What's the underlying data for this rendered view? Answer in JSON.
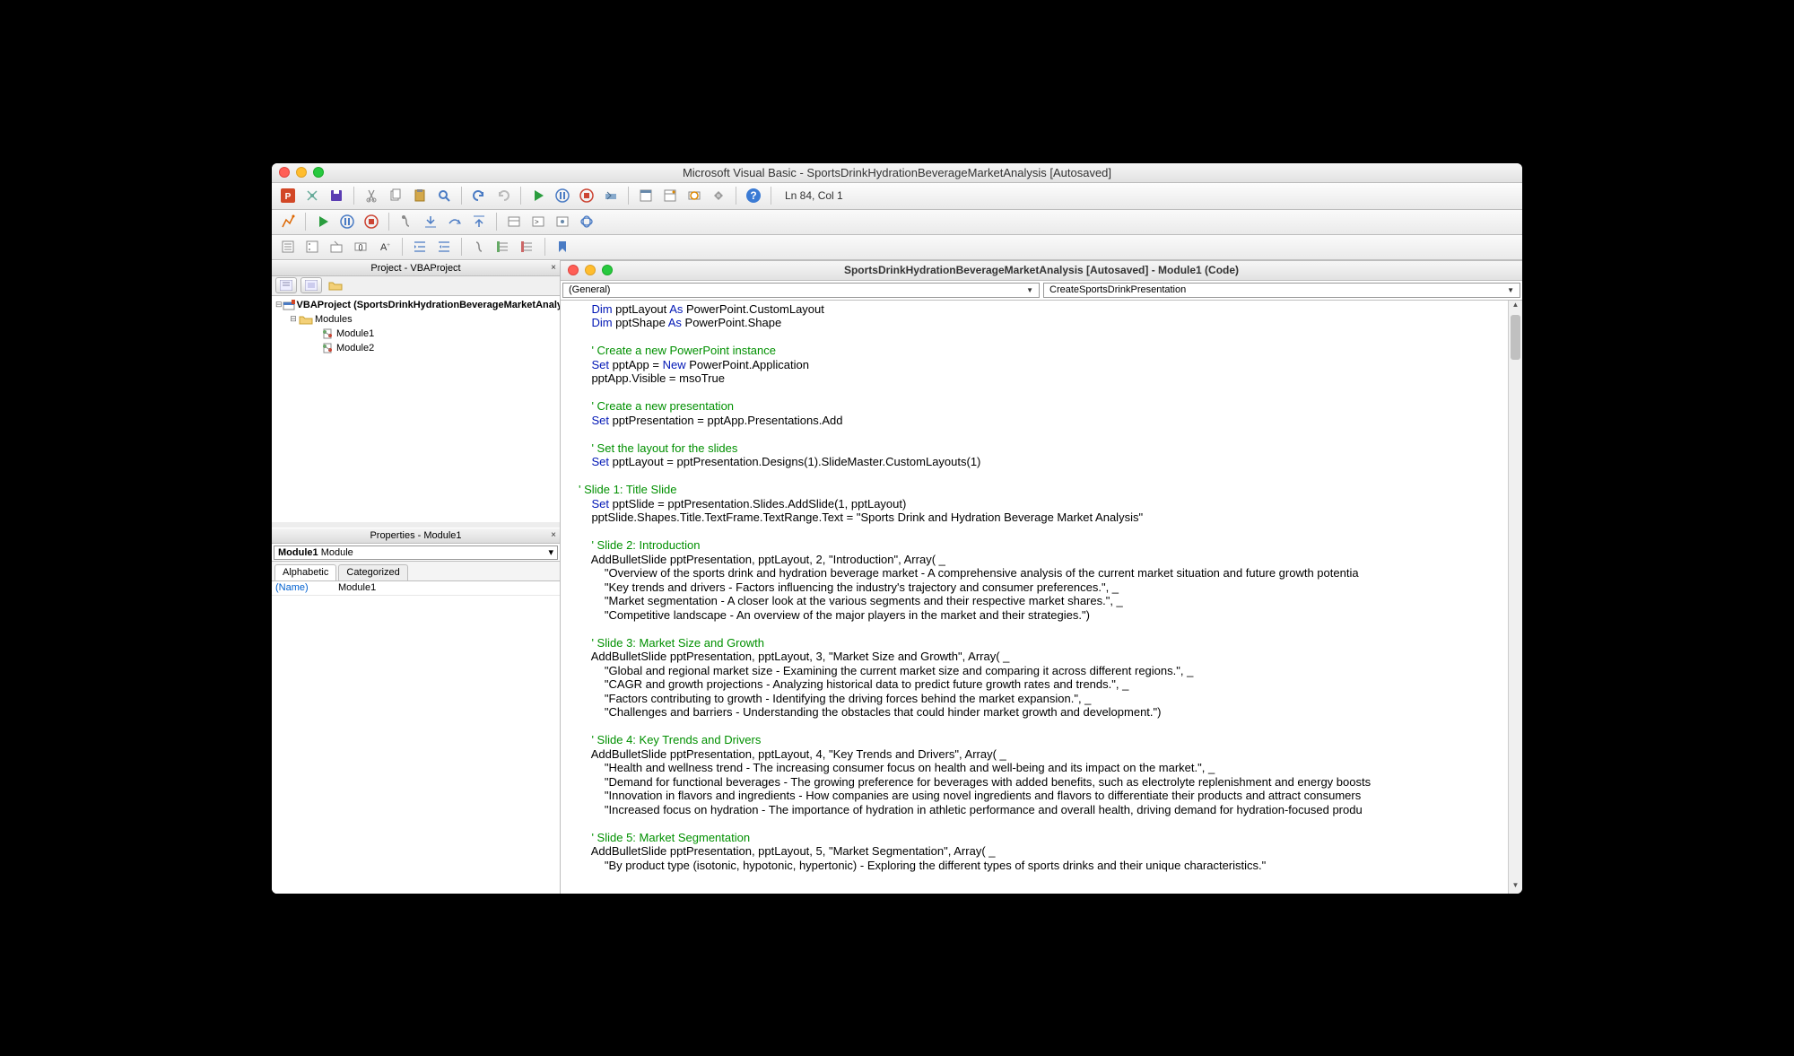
{
  "window": {
    "title": "Microsoft Visual Basic - SportsDrinkHydrationBeverageMarketAnalysis [Autosaved]"
  },
  "toolbar1": {
    "cursor_pos": "Ln 84, Col 1"
  },
  "project_pane": {
    "title": "Project - VBAProject",
    "root": "VBAProject (SportsDrinkHydrationBeverageMarketAnalys...)",
    "modules_folder": "Modules",
    "module1": "Module1",
    "module2": "Module2"
  },
  "properties_pane": {
    "title": "Properties - Module1",
    "select_label": "Module1",
    "select_type": "Module",
    "tab_alpha": "Alphabetic",
    "tab_cat": "Categorized",
    "name_key": "(Name)",
    "name_val": "Module1"
  },
  "code_window": {
    "title": "SportsDrinkHydrationBeverageMarketAnalysis [Autosaved] - Module1 (Code)",
    "dropdown_left": "(General)",
    "dropdown_right": "CreateSportsDrinkPresentation"
  },
  "code_lines": [
    {
      "indent": 1,
      "tokens": [
        [
          "kw",
          "Dim"
        ],
        [
          "",
          " pptLayout "
        ],
        [
          "kw",
          "As"
        ],
        [
          "",
          " PowerPoint.CustomLayout"
        ]
      ]
    },
    {
      "indent": 1,
      "tokens": [
        [
          "kw",
          "Dim"
        ],
        [
          "",
          " pptShape "
        ],
        [
          "kw",
          "As"
        ],
        [
          "",
          " PowerPoint.Shape"
        ]
      ]
    },
    {
      "indent": 0,
      "tokens": [
        [
          "",
          ""
        ]
      ]
    },
    {
      "indent": 1,
      "tokens": [
        [
          "cm",
          "' Create a new PowerPoint instance"
        ]
      ]
    },
    {
      "indent": 1,
      "tokens": [
        [
          "kw",
          "Set"
        ],
        [
          "",
          " pptApp = "
        ],
        [
          "kw",
          "New"
        ],
        [
          "",
          " PowerPoint.Application"
        ]
      ]
    },
    {
      "indent": 1,
      "tokens": [
        [
          "",
          "pptApp.Visible = msoTrue"
        ]
      ]
    },
    {
      "indent": 0,
      "tokens": [
        [
          "",
          ""
        ]
      ]
    },
    {
      "indent": 1,
      "tokens": [
        [
          "cm",
          "' Create a new presentation"
        ]
      ]
    },
    {
      "indent": 1,
      "tokens": [
        [
          "kw",
          "Set"
        ],
        [
          "",
          " pptPresentation = pptApp.Presentations.Add"
        ]
      ]
    },
    {
      "indent": 0,
      "tokens": [
        [
          "",
          ""
        ]
      ]
    },
    {
      "indent": 1,
      "tokens": [
        [
          "cm",
          "' Set the layout for the slides"
        ]
      ]
    },
    {
      "indent": 1,
      "tokens": [
        [
          "kw",
          "Set"
        ],
        [
          "",
          " pptLayout = pptPresentation.Designs(1).SlideMaster.CustomLayouts(1)"
        ]
      ]
    },
    {
      "indent": 0,
      "tokens": [
        [
          "",
          ""
        ]
      ]
    },
    {
      "indent": 0,
      "tokens": [
        [
          "cm",
          "' Slide 1: Title Slide"
        ]
      ]
    },
    {
      "indent": 1,
      "tokens": [
        [
          "kw",
          "Set"
        ],
        [
          "",
          " pptSlide = pptPresentation.Slides.AddSlide(1, pptLayout)"
        ]
      ]
    },
    {
      "indent": 1,
      "tokens": [
        [
          "",
          "pptSlide.Shapes.Title.TextFrame.TextRange.Text = \"Sports Drink and Hydration Beverage Market Analysis\""
        ]
      ]
    },
    {
      "indent": 0,
      "tokens": [
        [
          "",
          ""
        ]
      ]
    },
    {
      "indent": 1,
      "tokens": [
        [
          "cm",
          "' Slide 2: Introduction"
        ]
      ]
    },
    {
      "indent": 1,
      "tokens": [
        [
          "",
          "AddBulletSlide pptPresentation, pptLayout, 2, \"Introduction\", Array( _"
        ]
      ]
    },
    {
      "indent": 2,
      "tokens": [
        [
          "",
          "\"Overview of the sports drink and hydration beverage market - A comprehensive analysis of the current market situation and future growth potentia"
        ]
      ]
    },
    {
      "indent": 2,
      "tokens": [
        [
          "",
          "\"Key trends and drivers - Factors influencing the industry's trajectory and consumer preferences.\", _"
        ]
      ]
    },
    {
      "indent": 2,
      "tokens": [
        [
          "",
          "\"Market segmentation - A closer look at the various segments and their respective market shares.\", _"
        ]
      ]
    },
    {
      "indent": 2,
      "tokens": [
        [
          "",
          "\"Competitive landscape - An overview of the major players in the market and their strategies.\")"
        ]
      ]
    },
    {
      "indent": 0,
      "tokens": [
        [
          "",
          ""
        ]
      ]
    },
    {
      "indent": 1,
      "tokens": [
        [
          "cm",
          "' Slide 3: Market Size and Growth"
        ]
      ]
    },
    {
      "indent": 1,
      "tokens": [
        [
          "",
          "AddBulletSlide pptPresentation, pptLayout, 3, \"Market Size and Growth\", Array( _"
        ]
      ]
    },
    {
      "indent": 2,
      "tokens": [
        [
          "",
          "\"Global and regional market size - Examining the current market size and comparing it across different regions.\", _"
        ]
      ]
    },
    {
      "indent": 2,
      "tokens": [
        [
          "",
          "\"CAGR and growth projections - Analyzing historical data to predict future growth rates and trends.\", _"
        ]
      ]
    },
    {
      "indent": 2,
      "tokens": [
        [
          "",
          "\"Factors contributing to growth - Identifying the driving forces behind the market expansion.\", _"
        ]
      ]
    },
    {
      "indent": 2,
      "tokens": [
        [
          "",
          "\"Challenges and barriers - Understanding the obstacles that could hinder market growth and development.\")"
        ]
      ]
    },
    {
      "indent": 0,
      "tokens": [
        [
          "",
          ""
        ]
      ]
    },
    {
      "indent": 1,
      "tokens": [
        [
          "cm",
          "' Slide 4: Key Trends and Drivers"
        ]
      ]
    },
    {
      "indent": 1,
      "tokens": [
        [
          "",
          "AddBulletSlide pptPresentation, pptLayout, 4, \"Key Trends and Drivers\", Array( _"
        ]
      ]
    },
    {
      "indent": 2,
      "tokens": [
        [
          "",
          "\"Health and wellness trend - The increasing consumer focus on health and well-being and its impact on the market.\", _"
        ]
      ]
    },
    {
      "indent": 2,
      "tokens": [
        [
          "",
          "\"Demand for functional beverages - The growing preference for beverages with added benefits, such as electrolyte replenishment and energy boosts"
        ]
      ]
    },
    {
      "indent": 2,
      "tokens": [
        [
          "",
          "\"Innovation in flavors and ingredients - How companies are using novel ingredients and flavors to differentiate their products and attract consumers"
        ]
      ]
    },
    {
      "indent": 2,
      "tokens": [
        [
          "",
          "\"Increased focus on hydration - The importance of hydration in athletic performance and overall health, driving demand for hydration-focused produ"
        ]
      ]
    },
    {
      "indent": 0,
      "tokens": [
        [
          "",
          ""
        ]
      ]
    },
    {
      "indent": 1,
      "tokens": [
        [
          "cm",
          "' Slide 5: Market Segmentation"
        ]
      ]
    },
    {
      "indent": 1,
      "tokens": [
        [
          "",
          "AddBulletSlide pptPresentation, pptLayout, 5, \"Market Segmentation\", Array( _"
        ]
      ]
    },
    {
      "indent": 2,
      "tokens": [
        [
          "",
          "\"By product type (isotonic, hypotonic, hypertonic) - Exploring the different types of sports drinks and their unique characteristics.\""
        ]
      ]
    }
  ]
}
